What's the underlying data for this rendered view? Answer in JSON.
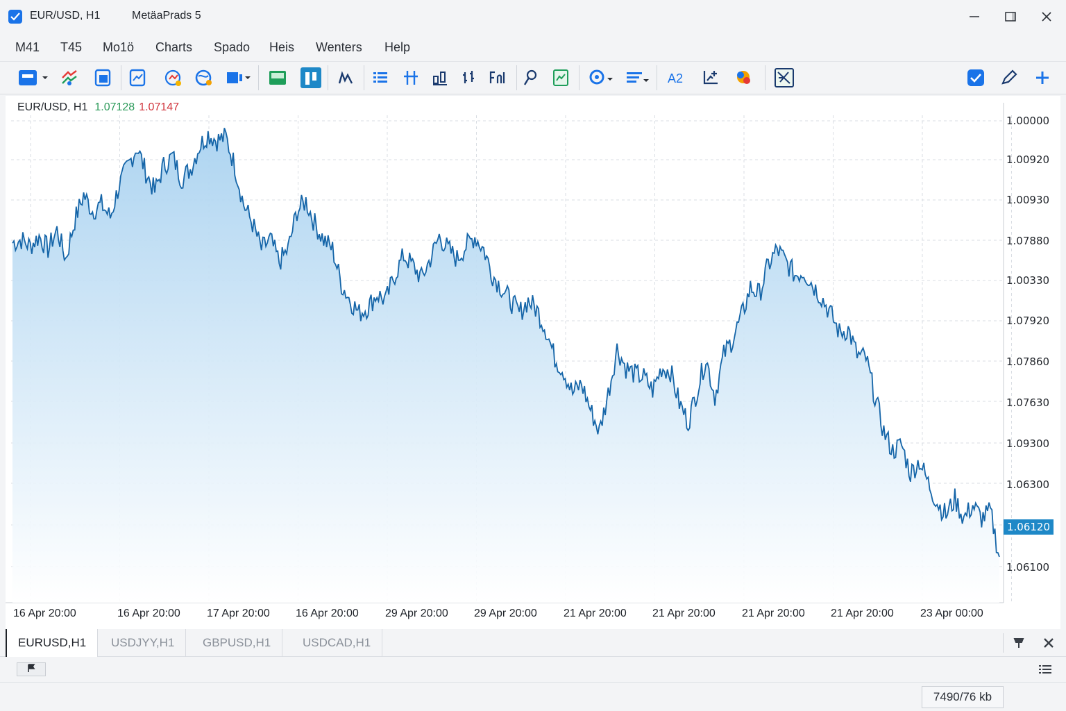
{
  "window": {
    "chart_title": "EUR/USD, H1",
    "app_title": "MetäaPrads 5"
  },
  "menu": [
    "M41",
    "T45",
    "Mo1ö",
    "Charts",
    "Spado",
    "Heis",
    "Wenters",
    "Help"
  ],
  "legend": {
    "symbol": "EUR/USD, H1",
    "bid": "1.07128",
    "ask": "1.07147"
  },
  "price_axis": [
    "1.00000",
    "1.00920",
    "1.00930",
    "1.07880",
    "1.00330",
    "1.07920",
    "1.07860",
    "1.07630",
    "1.09300",
    "1.06300",
    "1.06100"
  ],
  "current_price": "1.06120",
  "time_axis": [
    "16 Apr 20:00",
    "16 Apr 20:00",
    "17 Apr 20:00",
    "16 Apr 20:00",
    "29 Apr 20:00",
    "29 Apr 20:00",
    "21 Apr 20:00",
    "21 Apr 20:00",
    "21 Apr 20:00",
    "21 Apr 20:00",
    "23 Apr 00:00"
  ],
  "tabs": [
    "EURUSD,H1",
    "USDJYY,H1",
    "GBPUSD,H1",
    "USDCAD,H1"
  ],
  "status": {
    "memory": "7490/76 kb"
  },
  "colors": {
    "line": "#1565a8",
    "fill_top": "#a9d2f0",
    "bid": "#2c9a5a",
    "ask": "#d0323a",
    "current": "#1e88c7",
    "accent": "#1a73e8"
  },
  "chart_data": {
    "type": "area",
    "title": "EUR/USD, H1",
    "series": [
      {
        "name": "EUR/USD",
        "values": [
          1.0788,
          1.0789,
          1.0787,
          1.079,
          1.0786,
          1.0792,
          1.0783,
          1.0795,
          1.0803,
          1.0798,
          1.08,
          1.0796,
          1.0806,
          1.0812,
          1.0818,
          1.081,
          1.0804,
          1.0812,
          1.0815,
          1.0808,
          1.0811,
          1.0818,
          1.0822,
          1.082,
          1.0821,
          1.0812,
          1.08,
          1.0794,
          1.0786,
          1.0789,
          1.0782,
          1.0786,
          1.0798,
          1.0801,
          1.0794,
          1.0789,
          1.0786,
          1.0775,
          1.077,
          1.0766,
          1.0768,
          1.0772,
          1.077,
          1.0778,
          1.0784,
          1.0781,
          1.0777,
          1.0783,
          1.079,
          1.0786,
          1.0783,
          1.0787,
          1.079,
          1.0786,
          1.0778,
          1.0774,
          1.077,
          1.0766,
          1.077,
          1.0767,
          1.0761,
          1.0752,
          1.0748,
          1.0741,
          1.0744,
          1.0736,
          1.0729,
          1.0741,
          1.0755,
          1.0749,
          1.0747,
          1.0746,
          1.0742,
          1.0749,
          1.0748,
          1.0738,
          1.0732,
          1.0742,
          1.0752,
          1.074,
          1.0753,
          1.0758,
          1.0765,
          1.0774,
          1.0772,
          1.0781,
          1.0786,
          1.0782,
          1.0778,
          1.0779,
          1.0775,
          1.0771,
          1.0766,
          1.076,
          1.0761,
          1.0753,
          1.0752,
          1.074,
          1.0729,
          1.0723,
          1.0725,
          1.0716,
          1.072,
          1.0713,
          1.0707,
          1.0703,
          1.0708,
          1.0702,
          1.0706,
          1.0702,
          1.0704,
          1.069
        ]
      }
    ],
    "x_ticks": [
      "16 Apr 20:00",
      "16 Apr 20:00",
      "17 Apr 20:00",
      "16 Apr 20:00",
      "29 Apr 20:00",
      "29 Apr 20:00",
      "21 Apr 20:00",
      "21 Apr 20:00",
      "21 Apr 20:00",
      "21 Apr 20:00",
      "23 Apr 00:00"
    ],
    "y_ticks": [
      "1.00000",
      "1.00920",
      "1.00930",
      "1.07880",
      "1.00330",
      "1.07920",
      "1.07860",
      "1.07630",
      "1.09300",
      "1.06300",
      "1.06100"
    ],
    "ylim": [
      1.068,
      1.083
    ],
    "grid": true,
    "current_price": 1.0612
  }
}
